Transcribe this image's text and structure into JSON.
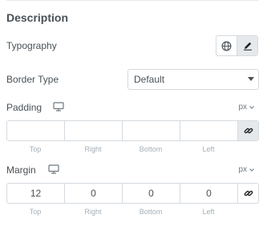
{
  "section": {
    "title": "Description"
  },
  "typography": {
    "label": "Typography",
    "globe_icon": "globe-icon",
    "edit_icon": "pencil-icon"
  },
  "border_type": {
    "label": "Border Type",
    "value": "Default"
  },
  "padding": {
    "label": "Padding",
    "device_icon": "desktop-icon",
    "unit": "px",
    "top": "",
    "right": "",
    "bottom": "",
    "left": "",
    "linked": true
  },
  "margin": {
    "label": "Margin",
    "device_icon": "desktop-icon",
    "unit": "px",
    "top": "12",
    "right": "0",
    "bottom": "0",
    "left": "0",
    "linked": false
  },
  "dimension_labels": {
    "top": "Top",
    "right": "Right",
    "bottom": "Bottom",
    "left": "Left"
  },
  "colors": {
    "text": "#495157",
    "border": "#d5dadf",
    "active_bg": "#e6e9ec",
    "caption": "#a4afb7"
  }
}
